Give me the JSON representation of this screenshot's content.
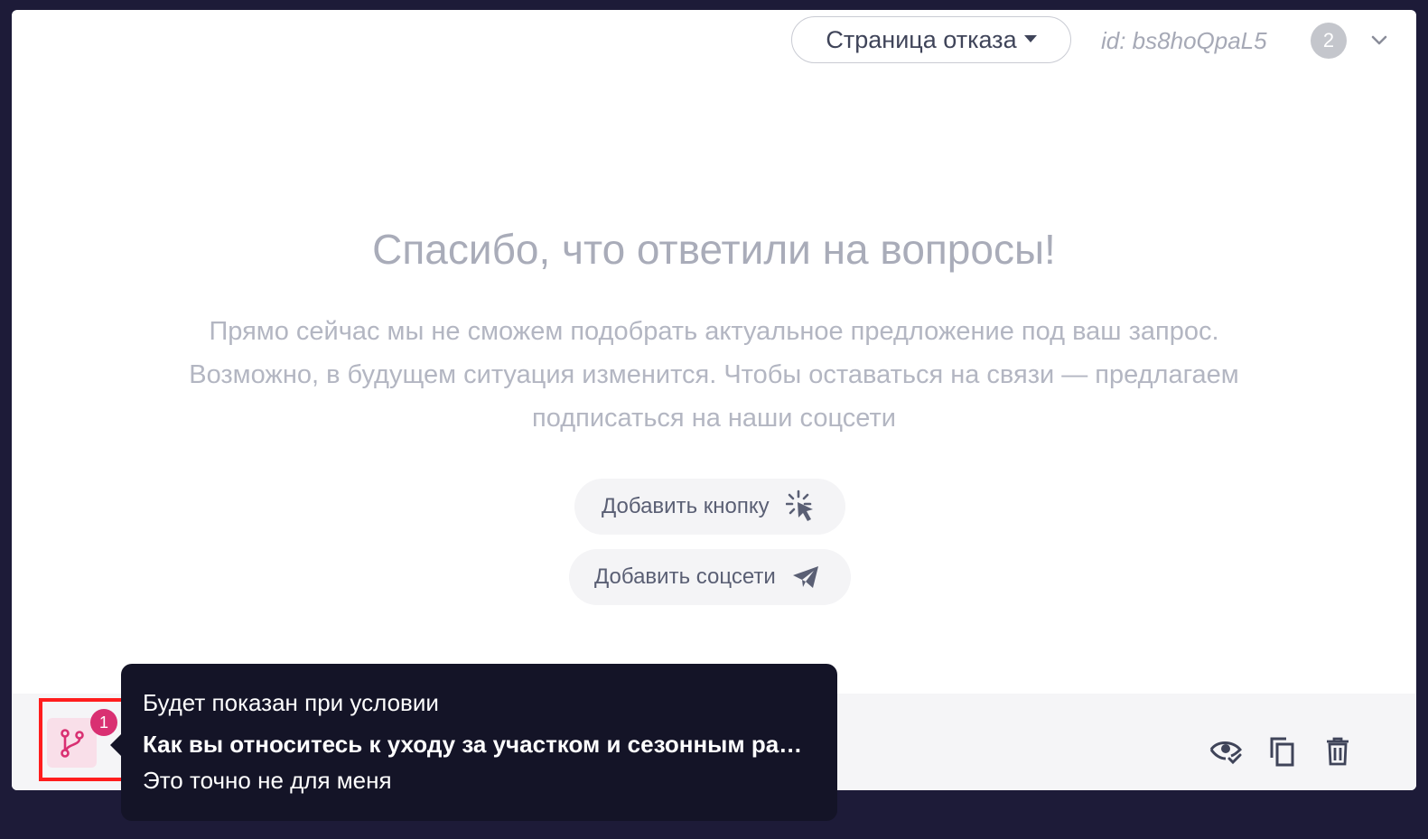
{
  "header": {
    "page_type_label": "Страница отказа",
    "block_id": "id: bs8hoQpaL5",
    "count_badge": "2"
  },
  "content": {
    "title": "Спасибо, что ответили на вопросы!",
    "description_lines": [
      "Прямо сейчас мы не сможем подобрать актуальное предложение под ваш запрос.",
      "Возможно, в будущем ситуация изменится. Чтобы оставаться на связи — предлагаем",
      "подписаться на наши соцсети"
    ],
    "add_button_label": "Добавить кнопку",
    "add_social_label": "Добавить соцсети"
  },
  "bottom_bar": {
    "condition_count": "1"
  },
  "tooltip": {
    "heading": "Будет показан при условии",
    "question": "Как вы относитесь к уходу за участком и сезонным работам?",
    "answer": "Это точно не для меня"
  },
  "colors": {
    "accent_pink": "#d93072",
    "tooltip_bg": "#141427",
    "highlight": "#ff1d1d"
  },
  "icons": {
    "caret": "caret-down-icon",
    "chevron": "chevron-down-icon",
    "add_button": "cursor-click-icon",
    "add_social": "paper-plane-icon",
    "condition": "branch-icon",
    "preview": "eye-check-icon",
    "copy": "copy-icon",
    "delete": "trash-icon"
  }
}
